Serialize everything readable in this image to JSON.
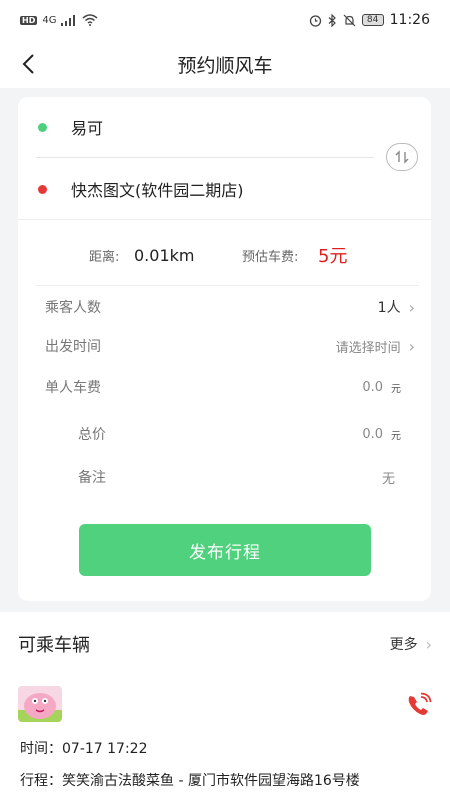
{
  "status_bar": {
    "hd_label": "HD",
    "network_label": "4G",
    "battery": "84",
    "time": "11:26"
  },
  "nav": {
    "title": "预约顺风车"
  },
  "route": {
    "start_name": "易可",
    "end_name": "快杰图文(软件园二期店)",
    "start_dot_color": "#4cd07d",
    "end_dot_color": "#e53935"
  },
  "fare": {
    "distance_label": "距离:",
    "distance_value": "0.01km",
    "estimate_label": "预估车费:",
    "estimate_value": "5元"
  },
  "form": {
    "passengers_label": "乘客人数",
    "passengers_value": "1人",
    "depart_label": "出发时间",
    "depart_value": "请选择时间",
    "per_fare_label": "单人车费",
    "per_fare_value": "0.0",
    "per_fare_unit": "元",
    "total_label": "总价",
    "total_value": "0.0",
    "total_unit": "元",
    "remark_label": "备注",
    "remark_value": "无"
  },
  "publish_button": "发布行程",
  "available": {
    "title": "可乘车辆",
    "more": "更多"
  },
  "vehicle": {
    "time_text": "时间：07-17 17:22",
    "route_text": "行程：笑笑渝古法酸菜鱼 - 厦门市软件园望海路16号楼"
  },
  "colors": {
    "accent_green": "#4fd17d",
    "price_red": "#e02020",
    "phone_red": "#e53935"
  }
}
